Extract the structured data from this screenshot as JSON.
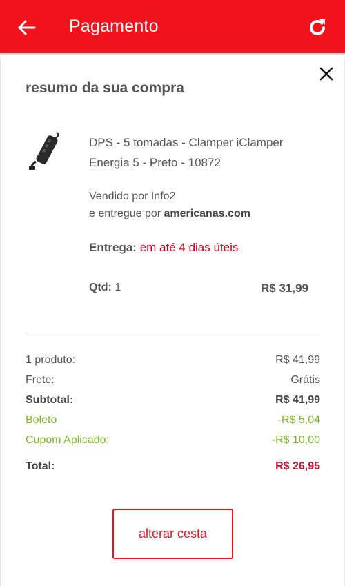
{
  "header": {
    "title": "Pagamento",
    "back_icon": "arrow-left-icon",
    "refresh_icon": "refresh-icon",
    "bg_color": "#f0131b"
  },
  "summary": {
    "title": "resumo da sua compra",
    "close_icon": "close-icon"
  },
  "product": {
    "name": "DPS - 5 tomadas - Clamper iClamper Energia 5 - Preto - 10872",
    "sold_by": "Vendido por Info2",
    "delivered_by_prefix": "e entregue por",
    "delivered_by": "americanas.com",
    "delivery_label": "Entrega:",
    "delivery_value": "em até 4 dias úteis",
    "qty_label": "Qtd:",
    "qty": "1",
    "price": "R$ 31,99"
  },
  "totals": {
    "rows": [
      {
        "label": "1 produto:",
        "value": "R$ 41,99"
      },
      {
        "label": "Frete:",
        "value": "Grátis"
      },
      {
        "label": "Subtotal:",
        "value": "R$ 41,99"
      },
      {
        "label": "Boleto",
        "value": "-R$ 5,04"
      },
      {
        "label": "Cupom Aplicado:",
        "value": "-R$ 10,00"
      },
      {
        "label": "Total:",
        "value": "R$ 26,95"
      }
    ]
  },
  "actions": {
    "alter_cart": "alterar cesta"
  },
  "colors": {
    "accent": "#e8141f",
    "discount": "#7ab81f",
    "total": "#c8102e"
  }
}
